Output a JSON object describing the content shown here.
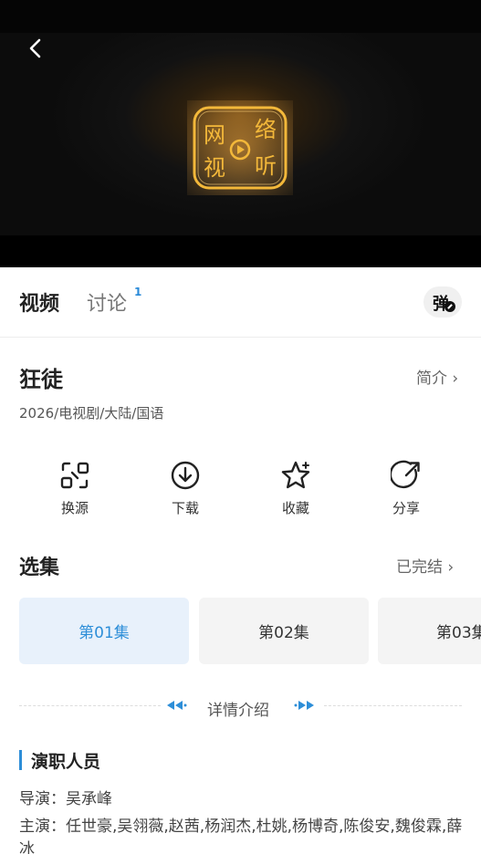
{
  "video": {
    "logo_text": [
      "网",
      "络",
      "视",
      "听"
    ]
  },
  "tabs": [
    {
      "label": "视频"
    },
    {
      "label": "讨论",
      "badge": "1"
    }
  ],
  "danmu_label": "弹",
  "show": {
    "title": "狂徒",
    "intro_link": "简介 ›",
    "meta": "2026/电视剧/大陆/国语"
  },
  "actions": [
    {
      "label": "换源",
      "icon": "switch-source-icon"
    },
    {
      "label": "下载",
      "icon": "download-icon"
    },
    {
      "label": "收藏",
      "icon": "star-icon"
    },
    {
      "label": "分享",
      "icon": "share-icon"
    }
  ],
  "episodes": {
    "title": "选集",
    "status": "已完结 ›",
    "items": [
      {
        "label": "第01集",
        "active": true
      },
      {
        "label": "第02集",
        "active": false
      },
      {
        "label": "第03集",
        "active": false
      }
    ]
  },
  "detail": {
    "label": "详情介绍"
  },
  "cast": {
    "title": "演职人员",
    "director": "导演：吴承峰",
    "actors": "主演：任世豪,吴翎薇,赵茜,杨润杰,杜姚,杨博奇,陈俊安,魏俊霖,薛冰"
  },
  "colors": {
    "accent": "#2d8ed8",
    "active_episode_bg": "#e8f1fb",
    "logo_gold": "#f3b83a"
  }
}
